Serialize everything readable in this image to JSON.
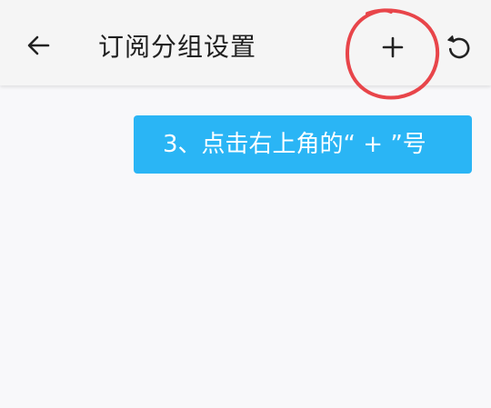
{
  "appbar": {
    "title": "订阅分组设置",
    "back_icon": "arrow-left-icon",
    "add_icon": "plus-icon",
    "refresh_icon": "refresh-icon"
  },
  "tip": {
    "text": "3、点击右上角的“ + ”号",
    "color": "#2ab5f5"
  },
  "annotation": {
    "color": "#e8454a"
  }
}
